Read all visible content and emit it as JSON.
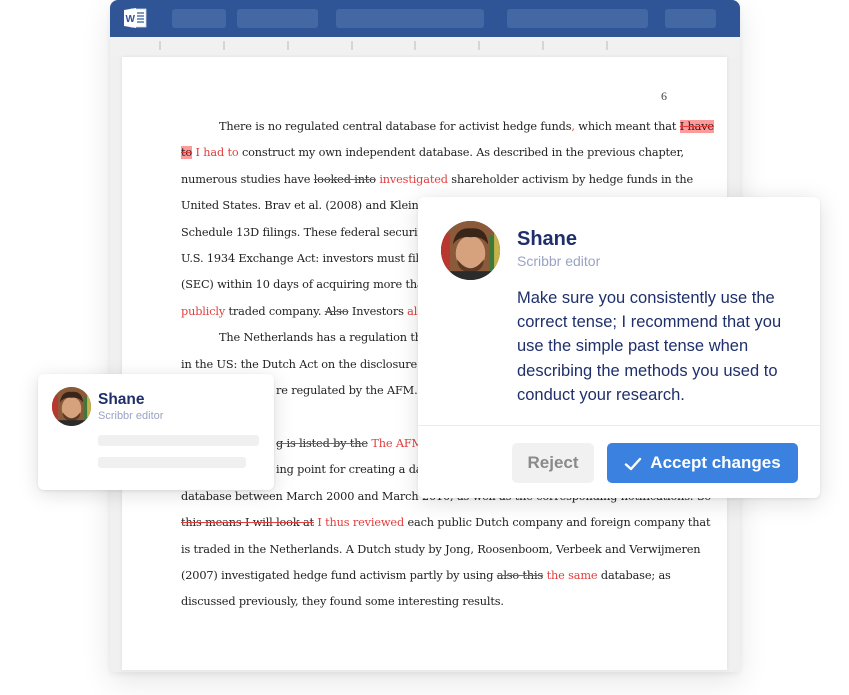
{
  "app": {
    "name": "Microsoft Word",
    "icon": "word-logo-icon",
    "brand_color": "#2f5597"
  },
  "document": {
    "page_number": "6",
    "paragraph1": {
      "l1_a": "There is no regulated central database for activist hedge funds",
      "l1_ins_comma": ",",
      "l1_b": " which meant that ",
      "l1_del_hl": "I have",
      "l2_del_hl": "to",
      "l2_ins": "I had to",
      "l2_b": " construct my own independent database. As described in the previous chapter,",
      "l3_a": "numerous studies have ",
      "l3_del": "looked into",
      "l3_ins": "investigated",
      "l3_b": " shareholder activism by hedge funds in the",
      "l4": "United States. Brav et al. (2008) and Klein and",
      "l5": "Schedule 13D filings. These federal security la",
      "l6": "U.S. 1934 Exchange Act: investors must file wi",
      "l7": "(SEC) within 10 days of acquiring more than 5",
      "l8_ins": "publicly",
      "l8_a": " traded company. ",
      "l8_del": "Also",
      "l8_b": " Investors ",
      "l8_ins2": "also",
      "l8_c": " h"
    },
    "paragraph2": {
      "l1": "The Netherlands has a regulation that i",
      "l2": "in the US: the Dutch Act on the disclosure of v",
      "l3": "re regulated by the AFM. Th",
      "l5_del": "g is listed by the",
      "l5_ins": "The AFM lis",
      "l6": "ing point for creating a data",
      "l7": "database between March 2000 and March 2010, as well as the corresponding notifications. So",
      "l8_del": "this means I will look at",
      "l8_ins": "I thus reviewed",
      "l8_b": " each public Dutch company and foreign company that",
      "l9": "is traded in the Netherlands. A Dutch study by Jong, Roosenboom, Verbeek and Verwijmeren",
      "l10_a": "(2007) investigated hedge fund activism partly by using ",
      "l10_del": "also this",
      "l10_ins": "the same",
      "l10_b": " database; as",
      "l11": "discussed previously, they found some interesting results."
    }
  },
  "comment": {
    "author": "Shane",
    "role": "Scribbr editor",
    "avatar": "editor-avatar",
    "message": "Make sure you consistently use the correct tense; I recommend that you use the simple past tense when describing the methods you used to conduct your research.",
    "reject_label": "Reject",
    "accept_label": "Accept changes",
    "accept_color": "#3b82e0"
  },
  "mini_comment": {
    "author": "Shane",
    "role": "Scribbr editor",
    "avatar": "editor-avatar"
  }
}
